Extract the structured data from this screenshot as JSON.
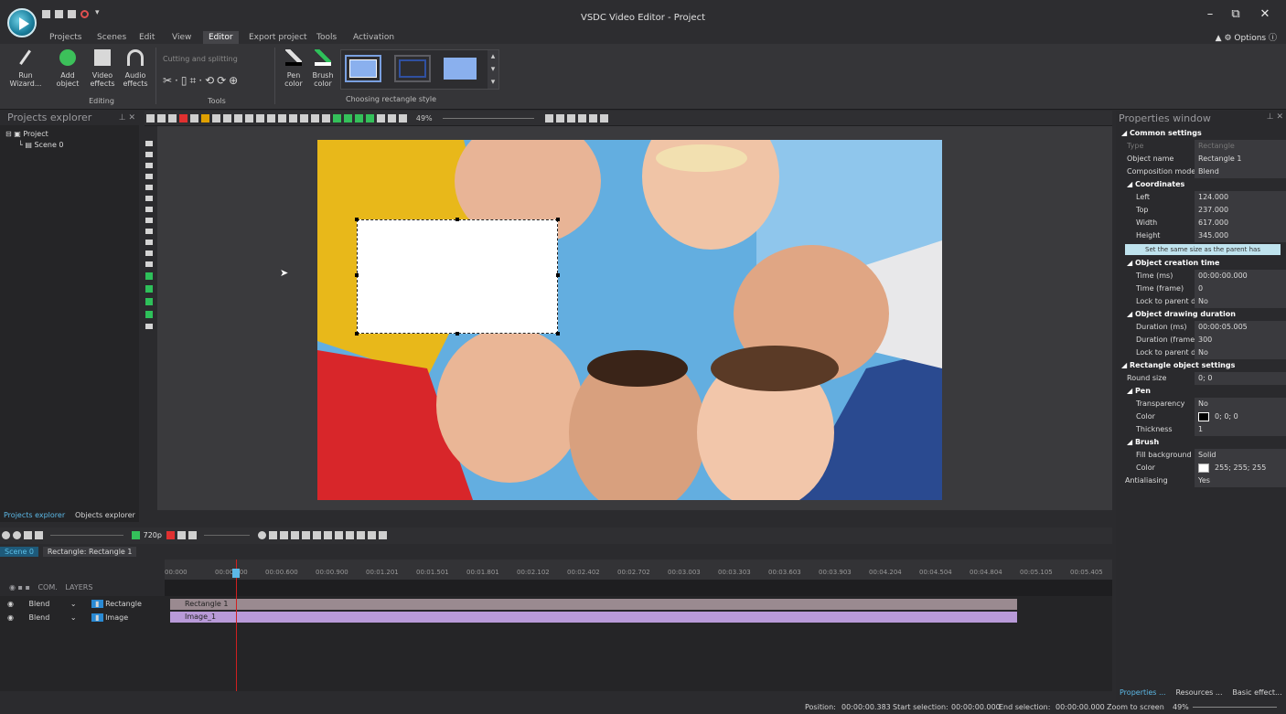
{
  "window": {
    "title": "VSDC Video Editor - Project",
    "minimize": "–",
    "maximize": "⧉",
    "close": "✕"
  },
  "menu": [
    "Projects",
    "Scenes",
    "Edit",
    "View",
    "Editor",
    "Export project",
    "Tools",
    "Activation"
  ],
  "menu_active": "Editor",
  "options_label": "Options",
  "ribbon": {
    "run_wizard": "Run Wizard...",
    "add_object": "Add object",
    "video_effects": "Video effects",
    "audio_effects": "Audio effects",
    "editing_group": "Editing",
    "cutting_splitting": "Cutting and splitting",
    "tools_group": "Tools",
    "pen_color": "Pen color",
    "brush_color": "Brush color",
    "rect_style_group": "Choosing rectangle style"
  },
  "projects_explorer": {
    "title": "Projects explorer",
    "project": "Project",
    "scene": "Scene 0"
  },
  "left_tabs": [
    "Projects explorer",
    "Objects explorer"
  ],
  "editor_toolbar": {
    "zoom": "49%"
  },
  "properties": {
    "title": "Properties window",
    "common": "Common settings",
    "rows1": [
      [
        "Type",
        "Rectangle"
      ],
      [
        "Object name",
        "Rectangle 1"
      ],
      [
        "Composition mode",
        "Blend"
      ]
    ],
    "coords": "Coordinates",
    "coord_rows": [
      [
        "Left",
        "124.000"
      ],
      [
        "Top",
        "237.000"
      ],
      [
        "Width",
        "617.000"
      ],
      [
        "Height",
        "345.000"
      ]
    ],
    "parent_btn": "Set the same size as the parent has",
    "creation": "Object creation time",
    "creation_rows": [
      [
        "Time (ms)",
        "00:00:00.000"
      ],
      [
        "Time (frame)",
        "0"
      ],
      [
        "Lock to parent du",
        "No"
      ]
    ],
    "duration": "Object drawing duration",
    "duration_rows": [
      [
        "Duration (ms)",
        "00:00:05.005"
      ],
      [
        "Duration (frames)",
        "300"
      ],
      [
        "Lock to parent du",
        "No"
      ]
    ],
    "rect_settings": "Rectangle object settings",
    "round_size": [
      "Round size",
      "0; 0"
    ],
    "pen": "Pen",
    "pen_rows": [
      [
        "Transparency",
        "No"
      ],
      [
        "Color",
        "0; 0; 0"
      ],
      [
        "Thickness",
        "1"
      ]
    ],
    "brush": "Brush",
    "brush_rows": [
      [
        "Fill background",
        "Solid"
      ],
      [
        "Color",
        "255; 255; 255"
      ]
    ],
    "antialiasing": [
      "Antialiasing",
      "Yes"
    ]
  },
  "prop_tabs": [
    "Properties ...",
    "Resources ...",
    "Basic effect..."
  ],
  "timeline": {
    "resolution": "720p",
    "tabs": [
      "Scene 0",
      "Rectangle: Rectangle 1"
    ],
    "ticks": [
      "00:000",
      "00:00.300",
      "00:00.600",
      "00:00.900",
      "00:01.201",
      "00:01.501",
      "00:01.801",
      "00:02.102",
      "00:02.402",
      "00:02.702",
      "00:03.003",
      "00:03.303",
      "00:03.603",
      "00:03.903",
      "00:04.204",
      "00:04.504",
      "00:04.804",
      "00:05.105",
      "00:05.405"
    ],
    "layers_header": "LAYERS",
    "com": "COM.",
    "tracks": [
      {
        "blend": "Blend",
        "name": "Rectangle",
        "clip": "Rectangle 1"
      },
      {
        "blend": "Blend",
        "name": "Image",
        "clip": "Image_1"
      }
    ]
  },
  "status": {
    "position_label": "Position:",
    "position": "00:00:00.383",
    "start_label": "Start selection:",
    "start": "00:00:00.000",
    "end_label": "End selection:",
    "end": "00:00:00.000",
    "zoom_label": "Zoom to screen",
    "zoom": "49%"
  },
  "colors": {
    "clip_rect": "#9a8a90",
    "clip_image": "#b89ad8",
    "accent": "#5cb8e6"
  }
}
